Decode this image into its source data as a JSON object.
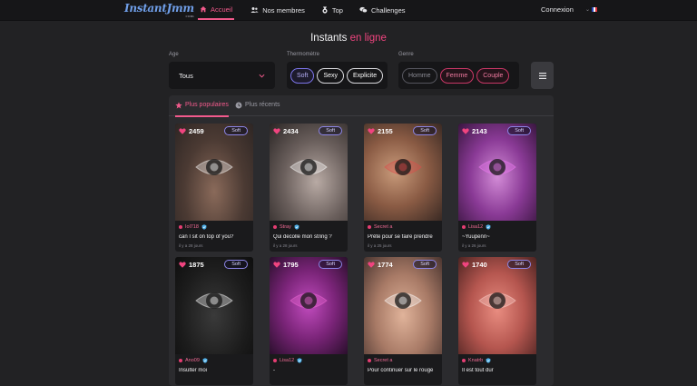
{
  "header": {
    "logo": "InstantJmm",
    "logo_sub": "com",
    "nav": [
      {
        "label": "Accueil",
        "icon": "home-icon",
        "active": true
      },
      {
        "label": "Nos membres",
        "icon": "users-icon",
        "active": false
      },
      {
        "label": "Top",
        "icon": "medal-icon",
        "active": false
      },
      {
        "label": "Challenges",
        "icon": "chat-bubbles-icon",
        "active": false
      }
    ],
    "login": "Connexion",
    "language_flag": "fr-flag-icon"
  },
  "page": {
    "title_main": "Instants",
    "title_accent": "en ligne"
  },
  "filters": {
    "age": {
      "label": "Age",
      "value": "Tous"
    },
    "thermometre": {
      "label": "Thermomètre",
      "options": [
        "Soft",
        "Sexy",
        "Explicite"
      ]
    },
    "genre": {
      "label": "Genre",
      "options": [
        "Homme",
        "Femme",
        "Couple"
      ]
    },
    "menu_icon": "hamburger-icon"
  },
  "tabs": {
    "popular": "Plus populaires",
    "recent": "Plus récents"
  },
  "colors": {
    "accent": "#f0447f",
    "soft_badge": "#8d86e8",
    "background": "#222224"
  },
  "cards": [
    {
      "likes": "2459",
      "badge": "Soft",
      "author": "Iol718",
      "verified": true,
      "caption": "can I sit on top of you?",
      "ago": "il y a 28 jours"
    },
    {
      "likes": "2434",
      "badge": "Soft",
      "author": "Stray",
      "verified": true,
      "caption": "Qui decolle mon string ?",
      "ago": "il y a 28 jours"
    },
    {
      "likes": "2155",
      "badge": "Soft",
      "author": "Secret a",
      "verified": false,
      "caption": "Prête pour se faire prendre",
      "ago": "il y a 25 jours"
    },
    {
      "likes": "2143",
      "badge": "Soft",
      "author": "Lisa12",
      "verified": true,
      "caption": "~Yuupenn~",
      "ago": "il y a 26 jours"
    },
    {
      "likes": "1875",
      "badge": "Soft",
      "author": "Ano09",
      "verified": true,
      "caption": "Insulter moi",
      "ago": ""
    },
    {
      "likes": "1795",
      "badge": "Soft",
      "author": "Lisa12",
      "verified": true,
      "caption": "-",
      "ago": ""
    },
    {
      "likes": "1774",
      "badge": "Soft",
      "author": "Secret a",
      "verified": false,
      "caption": "Pour continuer sur le rouge",
      "ago": ""
    },
    {
      "likes": "1740",
      "badge": "Soft",
      "author": "Knatrb",
      "verified": true,
      "caption": "Il est tout dur",
      "ago": ""
    }
  ]
}
